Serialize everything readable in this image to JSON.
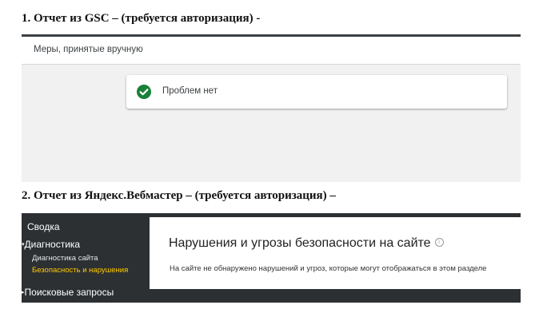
{
  "headings": {
    "gsc": "1. Отчет из GSC – (требуется авторизация) -",
    "yandex": "2. Отчет из Яндекс.Вебмастер – (требуется авторизация) –"
  },
  "gsc": {
    "header_label": "Меры, принятые вручную",
    "card_icon": "check-circle-icon",
    "card_text": "Проблем нет",
    "colors": {
      "check": "#188038",
      "top_line": "#3c4043",
      "background": "#f1f1f1"
    }
  },
  "yandex": {
    "sidebar": {
      "summary": "Сводка",
      "diagnostics": "Диагностика",
      "site_diagnostics": "Диагностика сайта",
      "security": "Безопасность и нарушения",
      "search_queries": "Поисковые запросы"
    },
    "main": {
      "title": "Нарушения и угрозы безопасности на сайте",
      "info_icon": "info-icon",
      "info_glyph": "i",
      "description": "На сайте не обнаружено нарушений и угроз, которые могут отображаться в этом разделе"
    },
    "colors": {
      "sidebar_bg": "#2d3033",
      "active_item": "#ffcc00"
    }
  }
}
